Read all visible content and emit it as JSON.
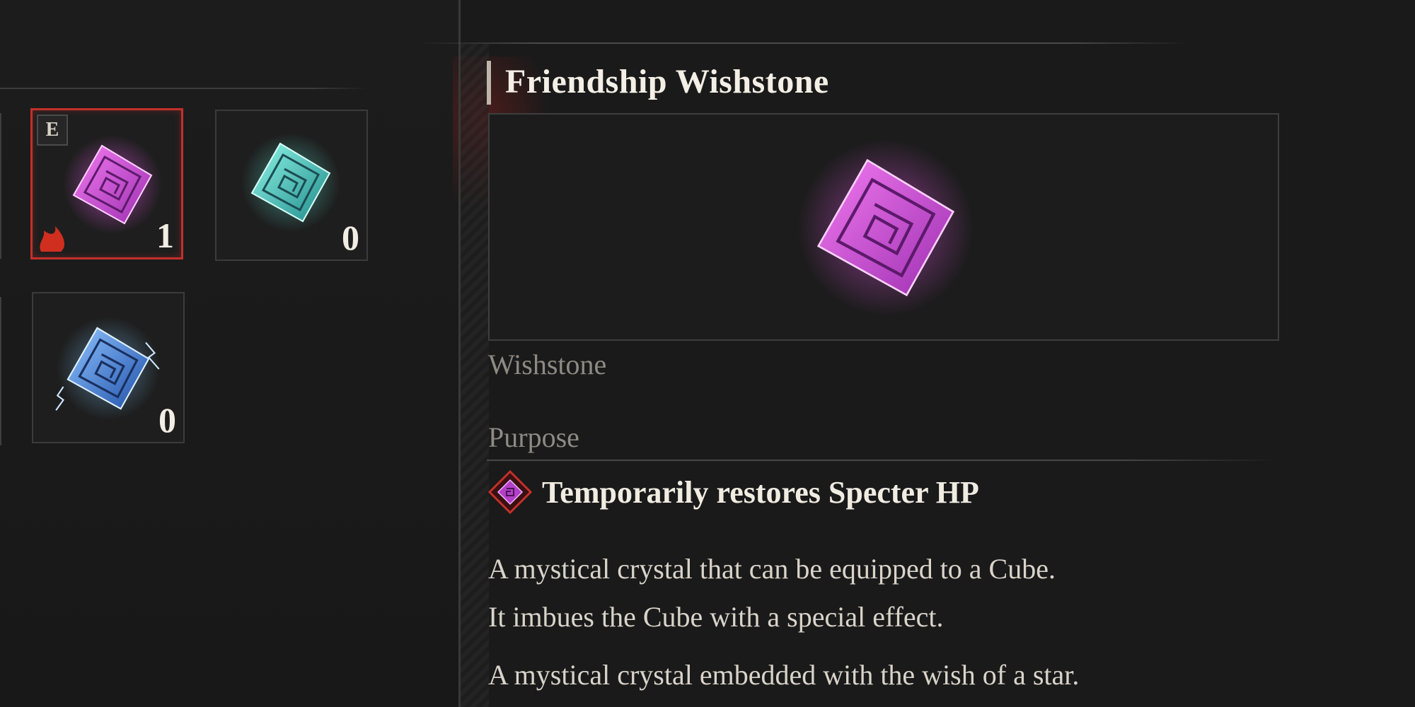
{
  "inventory": {
    "slots": [
      {
        "name": "Friendship Wishstone",
        "count": "1",
        "equipped_badge": "E",
        "selected": true,
        "gem_color": "#d44bd6"
      },
      {
        "name": "teal-wishstone",
        "count": "0",
        "selected": false,
        "gem_color": "#37c9c0"
      },
      {
        "name": "blue-wishstone",
        "count": "0",
        "selected": false,
        "gem_color": "#3e86e0"
      }
    ]
  },
  "detail": {
    "title": "Friendship Wishstone",
    "category": "Wishstone",
    "purpose_label": "Purpose",
    "purpose_text": "Temporarily restores Specter HP",
    "description": [
      "A mystical crystal that can be equipped to a Cube.",
      "It imbues the Cube with a special effect.",
      "A mystical crystal embedded with the wish of a star."
    ]
  },
  "colors": {
    "selection": "#c4302b",
    "pink_gem": "#d44bd6",
    "teal_gem": "#37c9c0",
    "blue_gem": "#3e86e0"
  },
  "icons": {
    "equipped": "equipped-badge-icon",
    "gem": "wishstone-gem-icon",
    "purpose": "specter-hp-icon"
  }
}
